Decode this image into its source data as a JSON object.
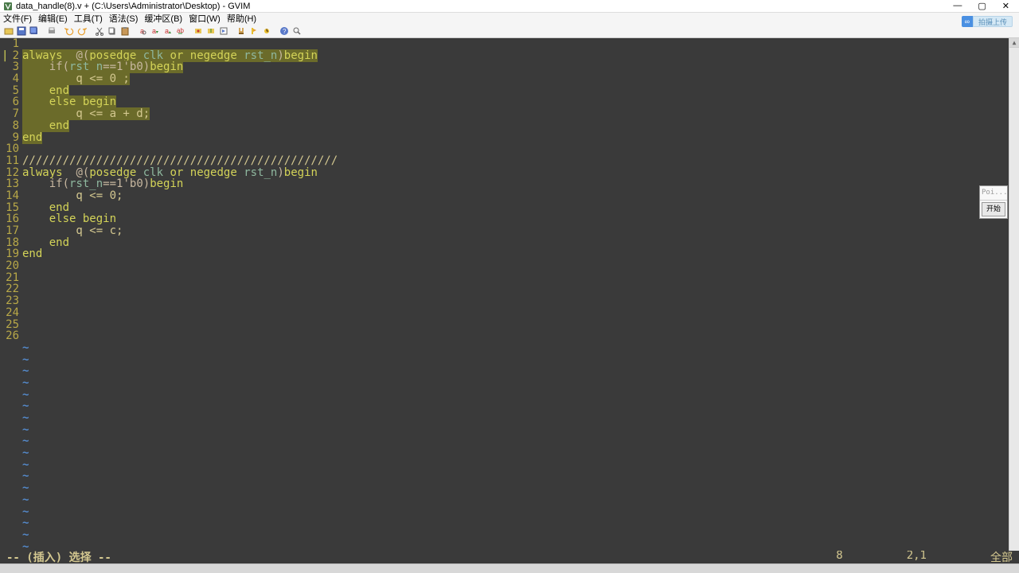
{
  "window": {
    "title": "data_handle(8).v + (C:\\Users\\Administrator\\Desktop) - GVIM",
    "min": "—",
    "max": "▢",
    "close": "✕"
  },
  "menu": {
    "file": "文件(F)",
    "edit": "编辑(E)",
    "tools": "工具(T)",
    "syntax": "语法(S)",
    "buffer": "缓冲区(B)",
    "window": "窗口(W)",
    "help": "帮助(H)"
  },
  "cloud": {
    "icon": "∞",
    "text": "拍摄上传"
  },
  "lines": [
    "",
    "",
    "",
    "",
    "",
    "",
    "",
    "",
    "",
    "",
    "",
    "",
    "",
    "",
    "",
    "",
    "",
    "",
    "",
    "",
    "",
    "",
    "",
    "",
    "",
    ""
  ],
  "lineno": [
    "1",
    "2",
    "3",
    "4",
    "5",
    "6",
    "7",
    "8",
    "9",
    "10",
    "11",
    "12",
    "13",
    "14",
    "15",
    "16",
    "17",
    "18",
    "19",
    "20",
    "21",
    "22",
    "23",
    "24",
    "25",
    "26"
  ],
  "code": {
    "l2": {
      "a": "always ",
      "b": " @(",
      "c": "posedge",
      "d": " clk ",
      "e": "or",
      "f": " negedge",
      "g": " rst_n",
      ")": ")",
      "h": "begin"
    },
    "l3": {
      "a": "    if(",
      "b": "rst_n",
      "c": "==1'b0)",
      "d": "begin"
    },
    "l4": "        q <= 0 ;",
    "l5": "    end",
    "l6": {
      "a": "    else ",
      "b": "begin"
    },
    "l7": "        q <= a + d;",
    "l8": "    end",
    "l9": "end",
    "l11": "///////////////////////////////////////////////",
    "l12": {
      "a": "always ",
      "b": " @(",
      "c": "posedge",
      "d": " clk ",
      "e": "or",
      "f": " negedge",
      "g": " rst_n",
      ")": ")",
      "h": "begin"
    },
    "l13": {
      "a": "    if(",
      "b": "rst_n",
      "c": "==1'b0)",
      "d": "begin"
    },
    "l14": "        q <= 0;",
    "l15": "    end",
    "l16": {
      "a": "    else ",
      "b": "begin"
    },
    "l17": "        q <= c;",
    "l18": "    end",
    "l19": "end"
  },
  "tilde": "~",
  "float": {
    "head": "Poi...",
    "btn": "开始"
  },
  "status": {
    "mode": "-- (插入) 选择 --",
    "line": "8",
    "col": "2,1",
    "pct": "全部"
  },
  "scroll": {
    "up": "▲"
  }
}
